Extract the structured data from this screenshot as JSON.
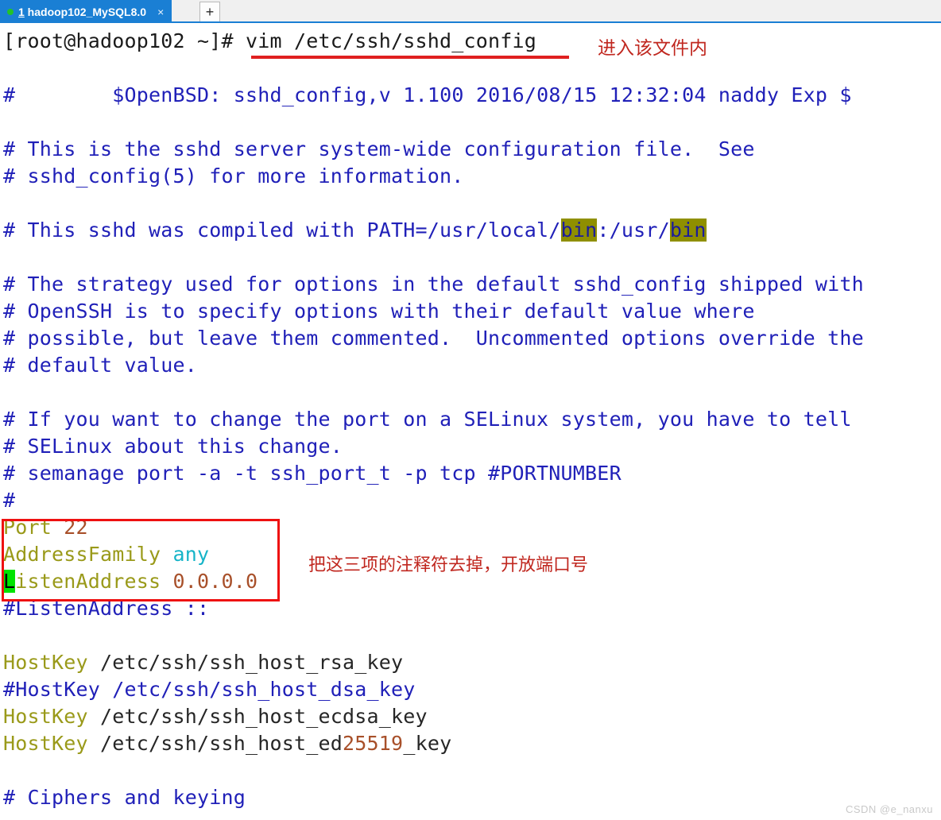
{
  "tabbar": {
    "tab": {
      "index": "1",
      "name": " hadoop102_MySQL8.0",
      "close_label": "×",
      "dot_color": "#22c32a"
    },
    "new_tab_label": "+"
  },
  "terminal": {
    "prompt": "[root@hadoop102 ~]# ",
    "command": "vim /etc/ssh/sshd_config",
    "lines": [
      "#         $OpenBSD: sshd_config,v 1.100 2016/08/15 12:32:04 naddy Exp $",
      "",
      "# This is the sshd server system-wide configuration file.  See",
      "# sshd_config(5) for more information.",
      "",
      "# This sshd was compiled with PATH=/usr/local/bin:/usr/bin",
      "",
      "# The strategy used for options in the default sshd_config shipped with",
      "# OpenSSH is to specify options with their default value where",
      "# possible, but leave them commented.  Uncommented options override the",
      "# default value.",
      "",
      "# If you want to change the port on a SELinux system, you have to tell",
      "# SELinux about this change.",
      "# semanage port -a -t ssh_port_t -p tcp #PORTNUMBER",
      "#",
      "Port 22",
      "AddressFamily any",
      "ListenAddress 0.0.0.0",
      "#ListenAddress ::",
      "",
      "HostKey /etc/ssh/ssh_host_rsa_key",
      "#HostKey /etc/ssh/ssh_host_dsa_key",
      "HostKey /etc/ssh/ssh_host_ecdsa_key",
      "HostKey /etc/ssh/ssh_host_ed25519_key",
      "",
      "# Ciphers and keying"
    ],
    "header": {
      "hash": "#",
      "gap": "        ",
      "text": "$OpenBSD: sshd_config,v 1.100 2016/08/15 12:32:04 naddy Exp $"
    },
    "sshd_server_1": "# This is the sshd server system-wide configuration file.  See",
    "sshd_server_2": "# sshd_config(5) for more information.",
    "path_pre": "# This sshd was compiled with PATH=/usr/local/",
    "path_hl1": "bin",
    "path_mid": ":/usr/",
    "path_hl2": "bin",
    "strategy_1": "# The strategy used for options in the default sshd_config shipped with",
    "strategy_2": "# OpenSSH is to specify options with their default value where",
    "strategy_3": "# possible, but leave them commented.  Uncommented options override the",
    "strategy_4": "# default value.",
    "selinux_1": "# If you want to change the port on a SELinux system, you have to tell",
    "selinux_2": "# SELinux about this change.",
    "selinux_3": "# semanage port -a -t ssh_port_t -p tcp #PORTNUMBER",
    "hash_only": "#",
    "port_kw": "Port ",
    "port_val": "22",
    "addressfamily_kw": "AddressFamily ",
    "addressfamily_val": "any",
    "listenaddress_cursor": "L",
    "listenaddress_kw": "istenAddress ",
    "listenaddress_val": "0.0.0.0",
    "listenaddress_commented": "#ListenAddress ::",
    "hostkey_kw": "HostKey ",
    "hostkey_rsa": "/etc/ssh/ssh_host_rsa_key",
    "hostkey_dsa_commented": "#HostKey /etc/ssh/ssh_host_dsa_key",
    "hostkey_ecdsa": "/etc/ssh/ssh_host_ecdsa_key",
    "hostkey_ed_pre": "/etc/ssh/ssh_host_ed",
    "hostkey_ed_num": "25519",
    "hostkey_ed_post": "_key",
    "ciphers": "# Ciphers and keying"
  },
  "annotations": {
    "enter_file": "进入该文件内",
    "uncomment_three": "把这三项的注释符去掉，开放端口号"
  },
  "watermark": "CSDN @e_nanxu",
  "colors": {
    "comment": "#2020b8",
    "keyword": "#9a9a1a",
    "number": "#a8502a",
    "special": "#16b4c8",
    "search_highlight": "#8f8f00",
    "cursor": "#00e400",
    "annotation_red": "#c0271f",
    "box_red": "#ee1111",
    "tab_blue": "#1a7fd4"
  }
}
